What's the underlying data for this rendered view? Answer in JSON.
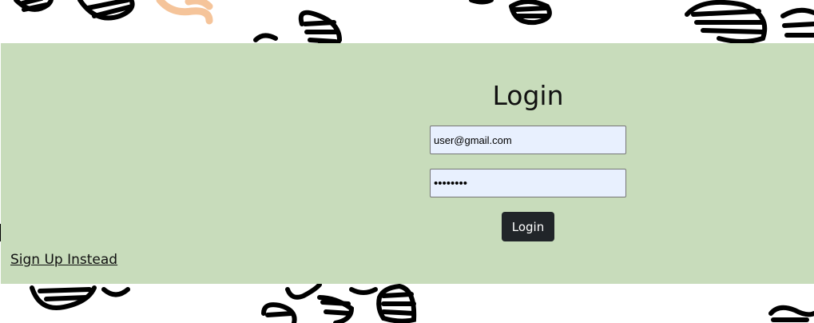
{
  "login": {
    "title": "Login",
    "email_value": "user@gmail.com",
    "password_value": "passwrd1",
    "button_label": "Login",
    "signup_link": "Sign Up Instead"
  },
  "colors": {
    "panel_bg": "#c8dcbb",
    "input_bg": "#e8f0fe",
    "button_bg": "#212529",
    "button_text": "#ffffff",
    "doodle_black": "#000000",
    "doodle_peach": "#f5c49a"
  }
}
